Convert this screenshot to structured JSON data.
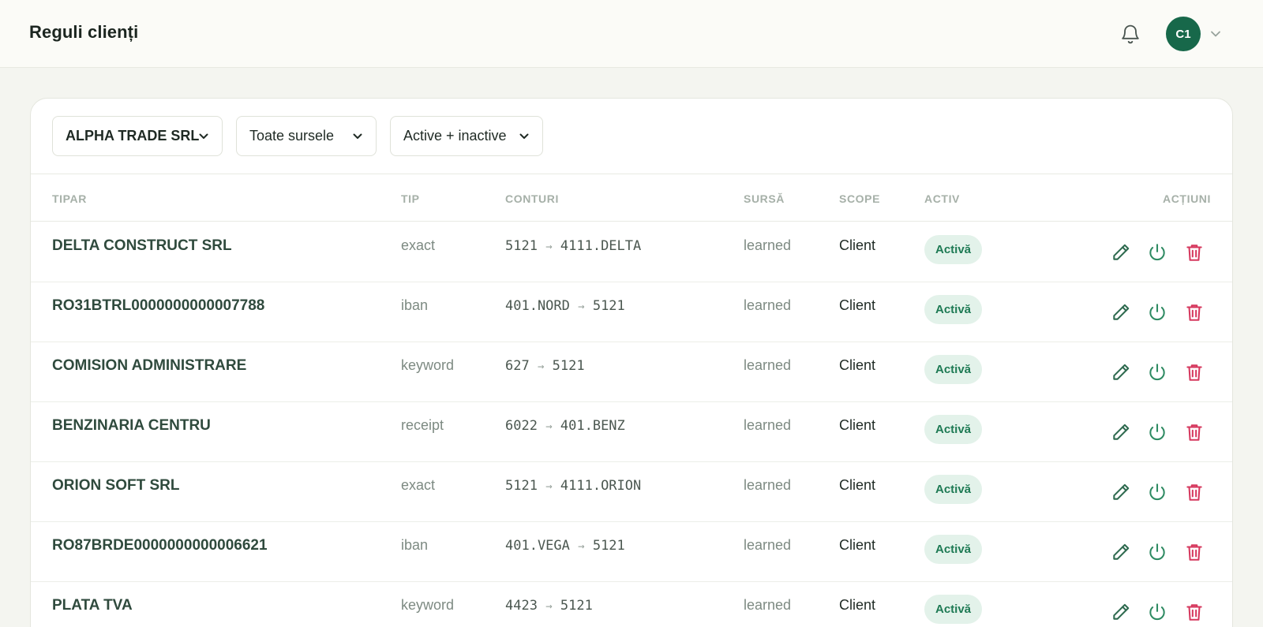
{
  "header": {
    "title": "Reguli clienți",
    "avatar_initials": "C1"
  },
  "filters": {
    "company": "ALPHA TRADE SRL",
    "source": "Toate sursele",
    "status": "Active + inactive"
  },
  "table": {
    "columns": {
      "tipar": "TIPAR",
      "tip": "TIP",
      "conturi": "CONTURI",
      "sursa": "SURSĂ",
      "scope": "SCOPE",
      "activ": "ACTIV",
      "actiuni": "ACȚIUNI"
    },
    "rows": [
      {
        "tipar": "DELTA CONSTRUCT SRL",
        "tip": "exact",
        "from": "5121",
        "to": "4111.DELTA",
        "sursa": "learned",
        "scope": "Client",
        "status": "Activă"
      },
      {
        "tipar": "RO31BTRL0000000000007788",
        "tip": "iban",
        "from": "401.NORD",
        "to": "5121",
        "sursa": "learned",
        "scope": "Client",
        "status": "Activă"
      },
      {
        "tipar": "COMISION ADMINISTRARE",
        "tip": "keyword",
        "from": "627",
        "to": "5121",
        "sursa": "learned",
        "scope": "Client",
        "status": "Activă"
      },
      {
        "tipar": "BENZINARIA CENTRU",
        "tip": "receipt",
        "from": "6022",
        "to": "401.BENZ",
        "sursa": "learned",
        "scope": "Client",
        "status": "Activă"
      },
      {
        "tipar": "ORION SOFT SRL",
        "tip": "exact",
        "from": "5121",
        "to": "4111.ORION",
        "sursa": "learned",
        "scope": "Client",
        "status": "Activă"
      },
      {
        "tipar": "RO87BRDE0000000000006621",
        "tip": "iban",
        "from": "401.VEGA",
        "to": "5121",
        "sursa": "learned",
        "scope": "Client",
        "status": "Activă"
      },
      {
        "tipar": "PLATA TVA",
        "tip": "keyword",
        "from": "4423",
        "to": "5121",
        "sursa": "learned",
        "scope": "Client",
        "status": "Activă"
      }
    ]
  },
  "arrow_glyph": "→",
  "colors": {
    "brand_green": "#17684a",
    "badge_bg": "#e3f2ea",
    "badge_text": "#1e7a54",
    "edit_icon": "#2e6a4f",
    "power_icon": "#2e8a62",
    "trash_icon": "#d6385e"
  },
  "icons": {
    "bell": "bell-icon",
    "chevron": "chevron-down-icon",
    "edit": "pencil-icon",
    "toggle": "power-icon",
    "delete": "trash-icon"
  }
}
